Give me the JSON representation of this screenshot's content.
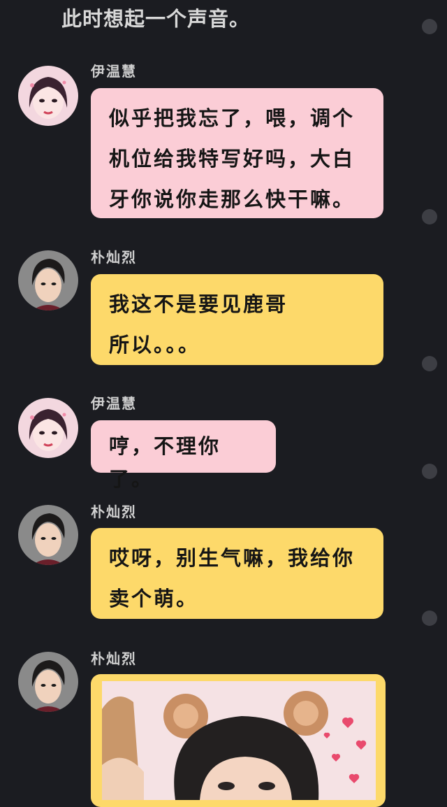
{
  "intro_text": "此时想起一个声音。",
  "messages": [
    {
      "sender": "伊温慧",
      "text": "似乎把我忘了，喂，调个机位给我特写好吗，大白牙你说你走那么快干嘛。",
      "style": "pink",
      "avatar": "girl-avatar"
    },
    {
      "sender": "朴灿烈",
      "text": "我这不是要见鹿哥所以。。。",
      "style": "yellow",
      "avatar": "boy-avatar"
    },
    {
      "sender": "伊温慧",
      "text": "哼，不理你了。",
      "style": "pink",
      "avatar": "girl-avatar"
    },
    {
      "sender": "朴灿烈",
      "text": "哎呀，别生气嘛，我给你卖个萌。",
      "style": "yellow",
      "avatar": "boy-avatar"
    },
    {
      "sender": "朴灿烈",
      "image": "bear-ears-photo",
      "style": "yellow",
      "avatar": "boy-avatar"
    }
  ],
  "colors": {
    "background": "#1b1c21",
    "pink_bubble": "#fbcdd6",
    "yellow_bubble": "#fdd96a",
    "scroll_dot": "#3d3e44"
  }
}
